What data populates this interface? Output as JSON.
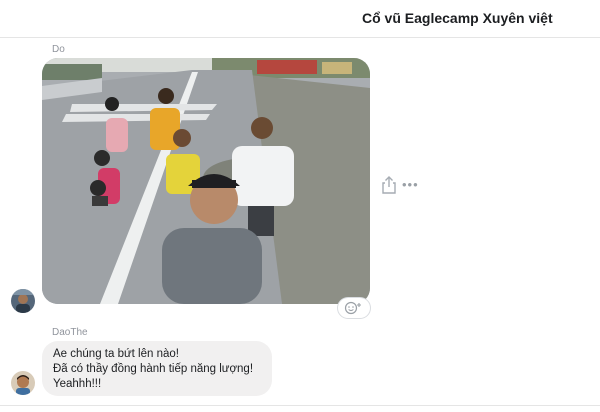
{
  "conversation": {
    "title": "Cổ vũ Eaglecamp Xuyên việt"
  },
  "messages": [
    {
      "sender": "Do",
      "type": "photo",
      "image_description": "Selfie of runners on a road with a motorbike behind"
    },
    {
      "sender": "DaoThe",
      "type": "text",
      "lines": [
        "Ae chúng ta bứt lên nào!",
        "Đã có thầy đồng hành tiếp năng lượng!",
        "Yeahhh!!!"
      ]
    }
  ],
  "icons": {
    "share": "share-icon",
    "more": "more-icon",
    "reaction": "add-reaction-icon"
  },
  "more_glyph": "•••",
  "colors": {
    "bubble": "#f1f0f0",
    "header_text": "#1c1e21",
    "sender_text": "#90949c"
  }
}
